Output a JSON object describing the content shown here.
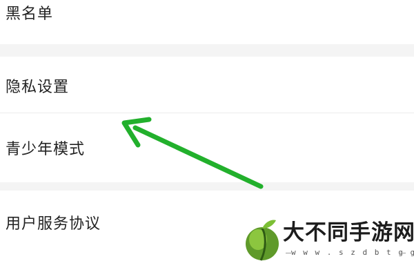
{
  "settings": {
    "items": [
      {
        "label": "黑名单"
      },
      {
        "label": "隐私设置"
      },
      {
        "label": "青少年模式"
      },
      {
        "label": "用户服务协议"
      }
    ]
  },
  "annotation": {
    "arrow_color": "#22b02c",
    "arrow_points_to": "隐私设置"
  },
  "watermark": {
    "title": "大不同手游网",
    "url": "w w w . s z d b t g g . c o m",
    "logo_color": "#6aa12e"
  }
}
